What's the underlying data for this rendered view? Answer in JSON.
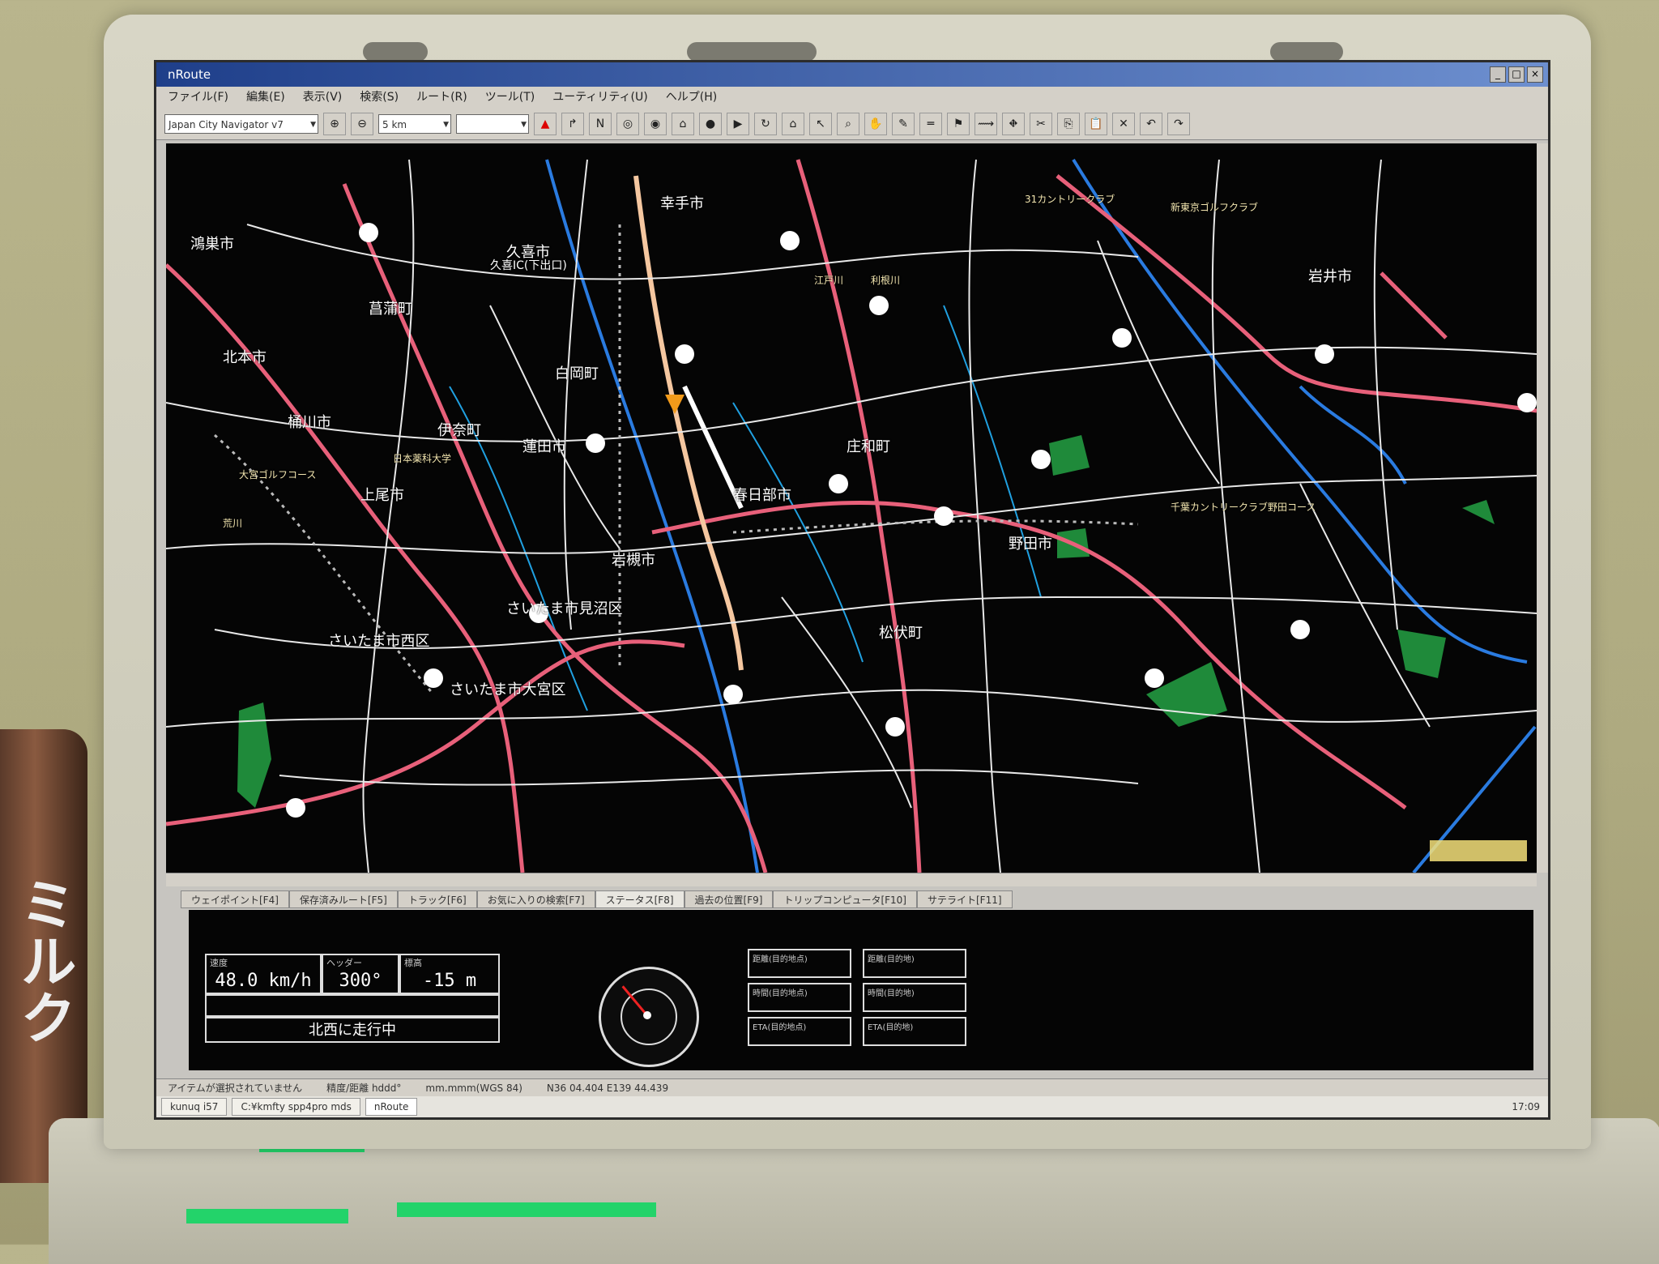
{
  "window": {
    "title": "nRoute"
  },
  "menu": [
    "ファイル(F)",
    "編集(E)",
    "表示(V)",
    "検索(S)",
    "ルート(R)",
    "ツール(T)",
    "ユーティリティ(U)",
    "ヘルプ(H)"
  ],
  "toolbar": {
    "map_combo": "Japan City Navigator v7",
    "scale_combo": "5 km",
    "zoom_in_icon": "zoom-in",
    "zoom_out_icon": "zoom-out"
  },
  "map_labels": {
    "koshigaya": "鴻巣市",
    "kuki": "久喜市",
    "kuki_ic": "久喜IC(下出口)",
    "shiraoka": "白岡町",
    "satte": "幸手市",
    "iwai": "岩井市",
    "kitamoto": "北本市",
    "okegawa": "桶川市",
    "ina": "伊奈町",
    "hasuda": "蓮田市",
    "shonan": "庄和町",
    "kasukabe": "春日部市",
    "ageo": "上尾市",
    "noda": "野田市",
    "iwatsuki": "岩槻市",
    "kitamura": "菖蒲町",
    "saitama_minuma": "さいたま市見沼区",
    "saitama_nishi": "さいたま市西区",
    "saitama_omiya": "さいたま市大宮区",
    "matsubushi": "松伏町",
    "edogawa": "江戸川",
    "tonegawa": "利根川",
    "arakawa": "荒川",
    "golf1": "大宮ゴルフコース",
    "golf2": "新東京ゴルフクラブ",
    "golf3": "31カントリークラブ",
    "univ": "日本薬科大学",
    "park": "千葉カントリークラブ野田コース"
  },
  "tabs": [
    "ウェイポイント[F4]",
    "保存済みルート[F5]",
    "トラック[F6]",
    "お気に入りの検索[F7]",
    "ステータス[F8]",
    "過去の位置[F9]",
    "トリップコンピュータ[F10]",
    "サテライト[F11]"
  ],
  "panel": {
    "speed_label": "速度",
    "speed_value": "48.0 km/h",
    "heading_label": "ヘッダー",
    "heading_value": "300°",
    "altitude_label": "標高",
    "altitude_value": "-15 m",
    "direction_text": "北西に走行中",
    "nav_labels": [
      "距離(目的地点)",
      "時間(目的地点)",
      "ETA(目的地点)",
      "距離(目的地)",
      "時間(目的地)",
      "ETA(目的地)"
    ]
  },
  "status": {
    "text1": "アイテムが選択されていません",
    "text2": "精度/距離 hddd°",
    "text3": "mm.mmm(WGS 84)",
    "coords": "N36 04.404 E139 44.439"
  },
  "taskbar": {
    "start": "kunuq i57",
    "item1": "C:¥kmfty spp4pro mds",
    "item2": "nRoute",
    "clock": "17:09"
  },
  "colors": {
    "map_bg": "#050505",
    "highway": "#e8607a",
    "river": "#2a7be0",
    "road": "#ffffff",
    "position": "#f29a1a"
  }
}
